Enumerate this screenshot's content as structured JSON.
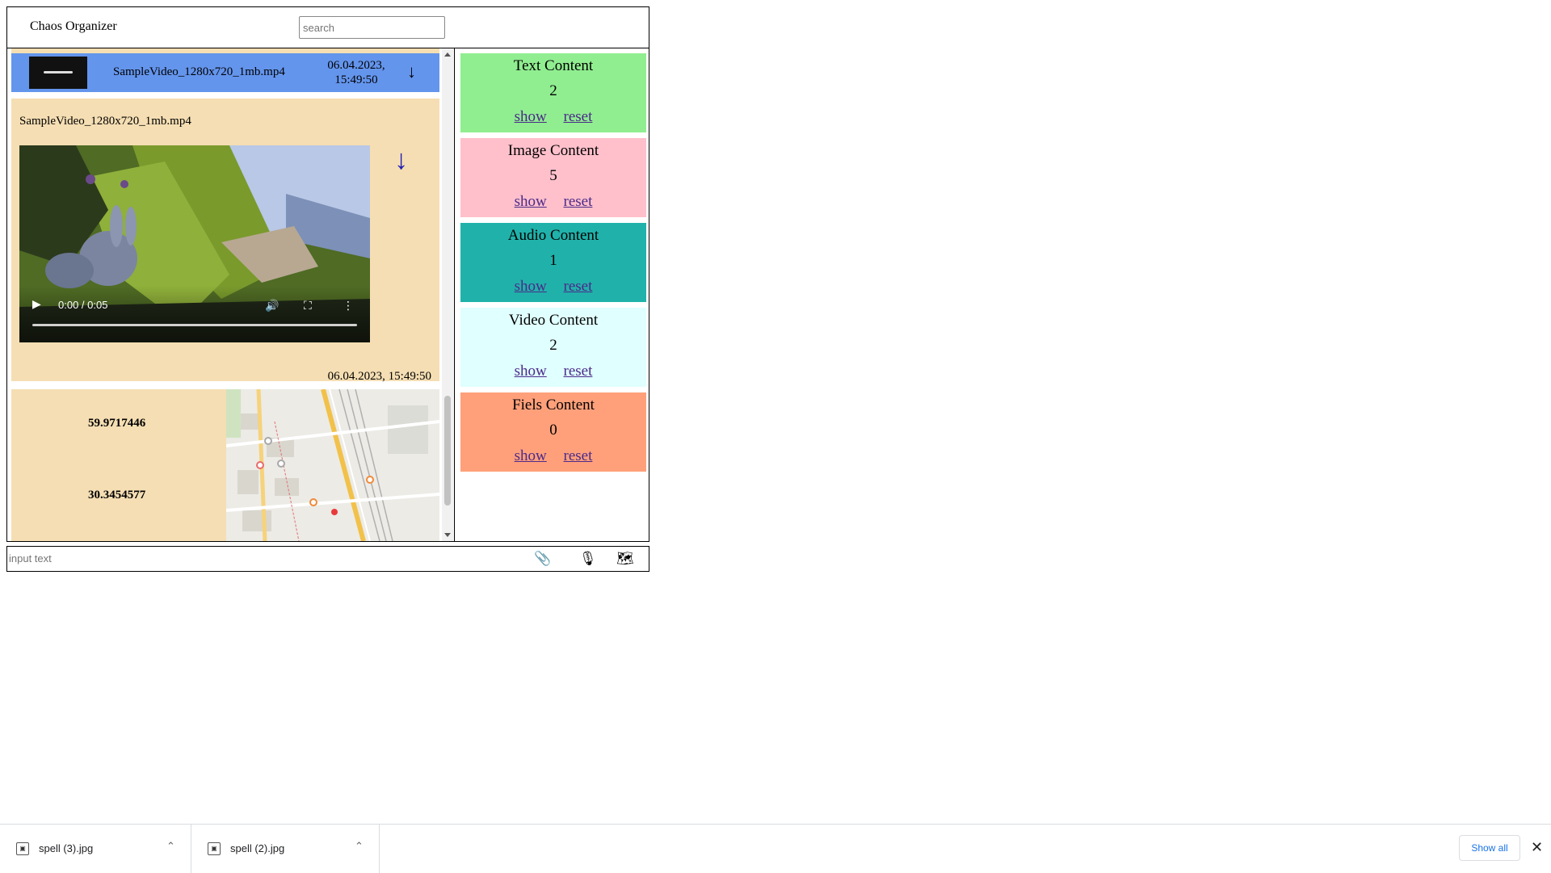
{
  "header": {
    "title": "Chaos Organizer",
    "search_placeholder": "search"
  },
  "feed": {
    "collapsed_message": {
      "file_name": "SampleVideo_1280x720_1mb.mp4",
      "date_line1": "06.04.2023,",
      "date_line2": "15:49:50",
      "download_icon": "down-arrow-icon"
    },
    "video_message": {
      "file_name": "SampleVideo_1280x720_1mb.mp4",
      "player_time": "0:00 / 0:05",
      "progress": 0,
      "date": "06.04.2023, 15:49:50",
      "download_icon": "down-arrow-icon"
    },
    "geo_message": {
      "latitude": "59.9717446",
      "longitude": "30.3454577"
    }
  },
  "stats": [
    {
      "title": "Text Content",
      "count": "2",
      "show": "show",
      "reset": "reset",
      "color": "#90ee90"
    },
    {
      "title": "Image Content",
      "count": "5",
      "show": "show",
      "reset": "reset",
      "color": "#ffc0cb"
    },
    {
      "title": "Audio Content",
      "count": "1",
      "show": "show",
      "reset": "reset",
      "color": "#20b2aa"
    },
    {
      "title": "Video Content",
      "count": "2",
      "show": "show",
      "reset": "reset",
      "color": "#e0ffff"
    },
    {
      "title": "Fiels Content",
      "count": "0",
      "show": "show",
      "reset": "reset",
      "color": "#ffa07a"
    }
  ],
  "input_bar": {
    "placeholder": "input text",
    "icons": [
      "paperclip-icon",
      "microphone-icon",
      "world-map-icon"
    ]
  },
  "downloads": {
    "items": [
      {
        "name": "spell (3).jpg"
      },
      {
        "name": "spell (2).jpg"
      }
    ],
    "show_all": "Show all"
  },
  "colors": {
    "collapsed_message": "#6495ed",
    "message_bg": "#f5deb3",
    "link": "#4b2a8a",
    "download_arrow": "#1f1fb4"
  }
}
